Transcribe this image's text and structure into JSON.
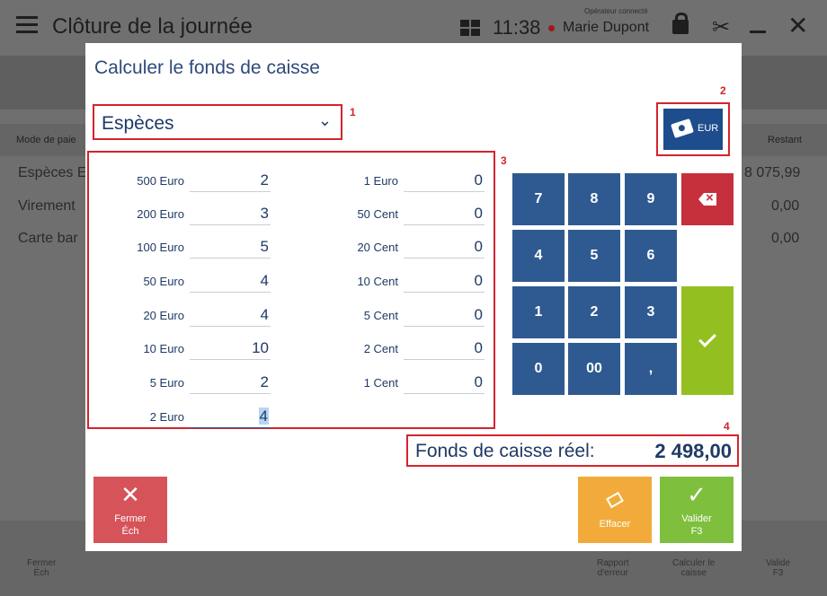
{
  "app": {
    "title": "Clôture de la journée",
    "time": "11:38",
    "operator_label": "Opérateur connecté",
    "operator_name": "Marie Dupont"
  },
  "background": {
    "col_left": "Mode de paie",
    "col_right": "Restant",
    "rows": [
      {
        "label": "Espèces E",
        "value": "8 075,99"
      },
      {
        "label": "Virement",
        "value": "0,00"
      },
      {
        "label": "Carte bar",
        "value": "0,00"
      }
    ],
    "bottom_buttons": [
      {
        "l1": "Fermer",
        "l2": "Éch"
      },
      {
        "l1": "Rapport",
        "l2": "d'erreur"
      },
      {
        "l1": "Calculer le",
        "l2": "caisse"
      },
      {
        "l1": "Valide",
        "l2": "F3"
      }
    ]
  },
  "dialog": {
    "title": "Calculer le fonds de caisse",
    "payment_select": "Espèces",
    "currency_button": "EUR",
    "annotations": [
      "1",
      "2",
      "3",
      "4"
    ],
    "denominations_left": [
      {
        "label": "500 Euro",
        "value": "2"
      },
      {
        "label": "200 Euro",
        "value": "3"
      },
      {
        "label": "100 Euro",
        "value": "5"
      },
      {
        "label": "50 Euro",
        "value": "4"
      },
      {
        "label": "20 Euro",
        "value": "4"
      },
      {
        "label": "10 Euro",
        "value": "10"
      },
      {
        "label": "5 Euro",
        "value": "2"
      },
      {
        "label": "2 Euro",
        "value": "4"
      }
    ],
    "denominations_right": [
      {
        "label": "1 Euro",
        "value": "0"
      },
      {
        "label": "50 Cent",
        "value": "0"
      },
      {
        "label": "20 Cent",
        "value": "0"
      },
      {
        "label": "10 Cent",
        "value": "0"
      },
      {
        "label": "5 Cent",
        "value": "0"
      },
      {
        "label": "2 Cent",
        "value": "0"
      },
      {
        "label": "1 Cent",
        "value": "0"
      }
    ],
    "keypad": {
      "k7": "7",
      "k8": "8",
      "k9": "9",
      "k4": "4",
      "k5": "5",
      "k6": "6",
      "k1": "1",
      "k2": "2",
      "k3": "3",
      "k0": "0",
      "k00": "00",
      "kcomma": ","
    },
    "total_label": "Fonds de caisse réel:",
    "total_value": "2 498,00",
    "buttons": {
      "close_l1": "Fermer",
      "close_l2": "Éch",
      "erase": "Effacer",
      "valid_l1": "Valider",
      "valid_l2": "F3"
    }
  }
}
